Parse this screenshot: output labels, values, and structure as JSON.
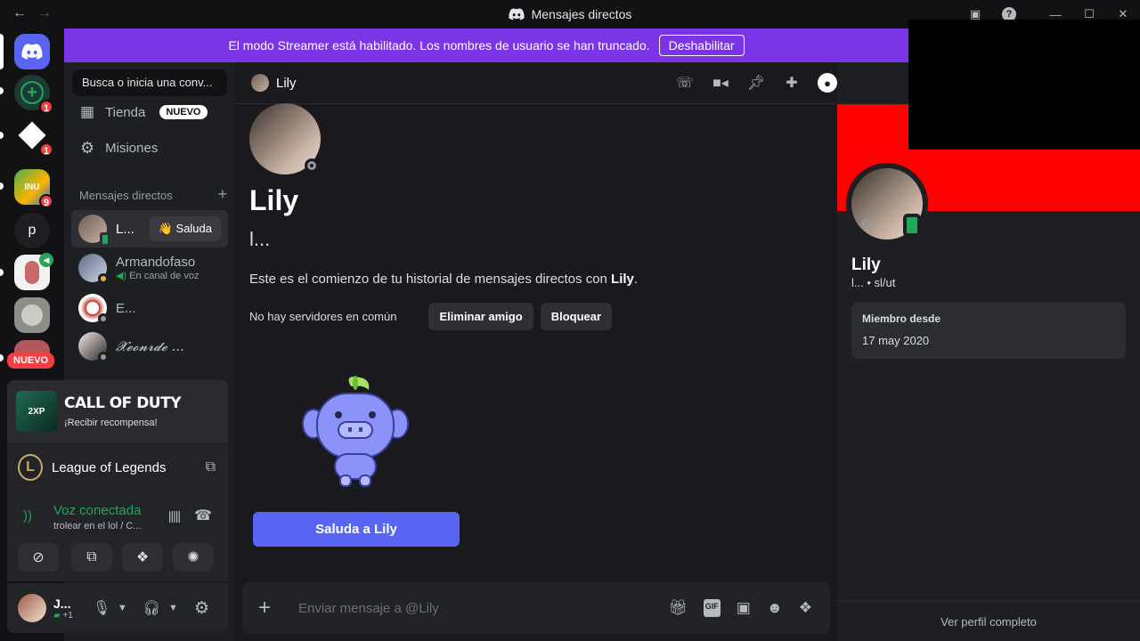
{
  "titlebar": {
    "title": "Mensajes directos",
    "back": "←",
    "forward": "→"
  },
  "banner": {
    "text": "El modo Streamer está habilitado. Los nombres de usuario se han truncado.",
    "button": "Deshabilitar"
  },
  "rail": {
    "badges": {
      "add": "1",
      "diamond": "1",
      "game": "9"
    },
    "server_p": "p",
    "new_label": "NUEVO"
  },
  "sidebar": {
    "search_placeholder": "Busca o inicia una conv...",
    "store": "Tienda",
    "store_badge": "NUEVO",
    "missions": "Misiones",
    "dm_header": "Mensajes directos",
    "dms": [
      {
        "name": "L...",
        "action": "👋 Saluda"
      },
      {
        "name": "Armandofaso",
        "sub": "En canal de voz"
      },
      {
        "name": "E..."
      },
      {
        "name": "𝓧𝓮𝓸𝓷𝓻𝓭𝓮 ..."
      }
    ]
  },
  "promo": {
    "title": "CALL OF DUTY",
    "subtitle": "¡Recibir recompensa!"
  },
  "game": {
    "name": "League of Legends"
  },
  "voice": {
    "status": "Voz conectada",
    "channel": "trolear en el lol / C..."
  },
  "user": {
    "name": "J...",
    "extra": "+1"
  },
  "chat": {
    "header_name": "Lily",
    "intro_name": "Lily",
    "intro_sub": "l...",
    "intro_text_prefix": "Este es el comienzo de tu historial de mensajes directos con ",
    "intro_text_name": "Lily",
    "intro_text_suffix": ".",
    "no_servers": "No hay servidores en común",
    "remove_friend": "Eliminar amigo",
    "block": "Bloquear",
    "wave_button": "Saluda a Lily",
    "composer_placeholder": "Enviar mensaje a @Lily",
    "gif_label": "GIF"
  },
  "profile": {
    "name": "Lily",
    "sub": "l... • sl/ut",
    "member_since_label": "Miembro desde",
    "member_since_value": "17 may 2020",
    "footer": "Ver perfil completo"
  },
  "colors": {
    "accent": "#5865f2",
    "streamer": "#7b35e6",
    "profile_banner": "#ff0000",
    "voice_green": "#23a55a"
  }
}
